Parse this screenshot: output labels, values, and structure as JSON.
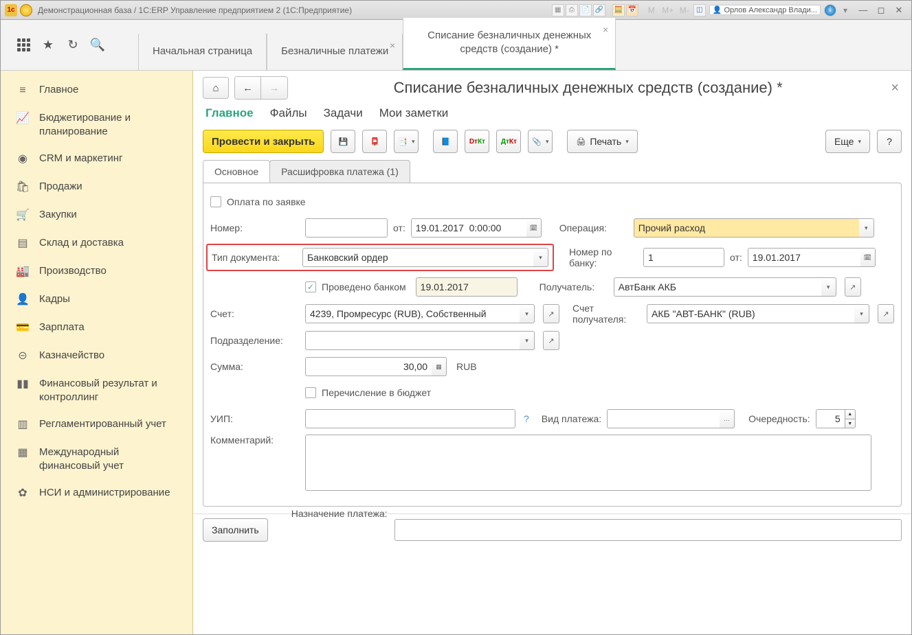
{
  "titlebar": {
    "app_title": "Демонстрационная база / 1С:ERP Управление предприятием 2  (1С:Предприятие)",
    "user": "Орлов Александр Влади...",
    "m_label": "M",
    "mplus_label": "M+",
    "mminus_label": "M-"
  },
  "top_tabs": [
    {
      "label": "Начальная страница",
      "closable": false,
      "active": false
    },
    {
      "label": "Безналичные платежи",
      "closable": true,
      "active": false
    },
    {
      "label": "Списание безналичных денежных средств (создание) *",
      "closable": true,
      "active": true
    }
  ],
  "sidebar": [
    {
      "icon": "menu",
      "label": "Главное"
    },
    {
      "icon": "chart",
      "label": "Бюджетирование и планирование"
    },
    {
      "icon": "pie",
      "label": "CRM и маркетинг"
    },
    {
      "icon": "bag",
      "label": "Продажи"
    },
    {
      "icon": "cart",
      "label": "Закупки"
    },
    {
      "icon": "box",
      "label": "Склад и доставка"
    },
    {
      "icon": "factory",
      "label": "Производство"
    },
    {
      "icon": "person",
      "label": "Кадры"
    },
    {
      "icon": "money",
      "label": "Зарплата"
    },
    {
      "icon": "coin",
      "label": "Казначейство"
    },
    {
      "icon": "bars",
      "label": "Финансовый результат и контроллинг"
    },
    {
      "icon": "doc",
      "label": "Регламентированный учет"
    },
    {
      "icon": "globe",
      "label": "Международный финансовый учет"
    },
    {
      "icon": "gear",
      "label": "НСИ и администрирование"
    }
  ],
  "document": {
    "title": "Списание безналичных денежных средств (создание) *",
    "tabs": [
      "Главное",
      "Файлы",
      "Задачи",
      "Мои заметки"
    ],
    "toolbar": {
      "post_close": "Провести и закрыть",
      "print": "Печать",
      "more": "Еще",
      "help": "?"
    },
    "sub_tabs": [
      "Основное",
      "Расшифровка платежа (1)"
    ],
    "form": {
      "pay_by_request": "Оплата по заявке",
      "number_label": "Номер:",
      "number_value": "",
      "from_label": "от:",
      "date_value": "19.01.2017  0:00:00",
      "operation_label": "Операция:",
      "operation_value": "Прочий расход",
      "doctype_label": "Тип документа:",
      "doctype_value": "Банковский ордер",
      "bank_number_label": "Номер по банку:",
      "bank_number_value": "1",
      "bank_from_label": "от:",
      "bank_date_value": "19.01.2017",
      "bank_posted_label": "Проведено банком",
      "bank_posted_date": "19.01.2017",
      "recipient_label": "Получатель:",
      "recipient_value": "АвтБанк АКБ",
      "account_label": "Счет:",
      "account_value": "4239, Промресурс (RUB), Собственный",
      "recipient_acc_label": "Счет получателя:",
      "recipient_acc_value": "АКБ \"АВТ-БАНК\" (RUB)",
      "department_label": "Подразделение:",
      "department_value": "",
      "sum_label": "Сумма:",
      "sum_value": "30,00",
      "currency": "RUB",
      "to_budget_label": "Перечисление в бюджет",
      "uip_label": "УИП:",
      "uip_value": "",
      "payment_type_label": "Вид платежа:",
      "payment_type_value": "",
      "priority_label": "Очередность:",
      "priority_value": "5",
      "comment_label": "Комментарий:",
      "comment_value": ""
    },
    "footer": {
      "purpose_label": "Назначение платежа:",
      "purpose_value": "",
      "fill": "Заполнить"
    }
  }
}
